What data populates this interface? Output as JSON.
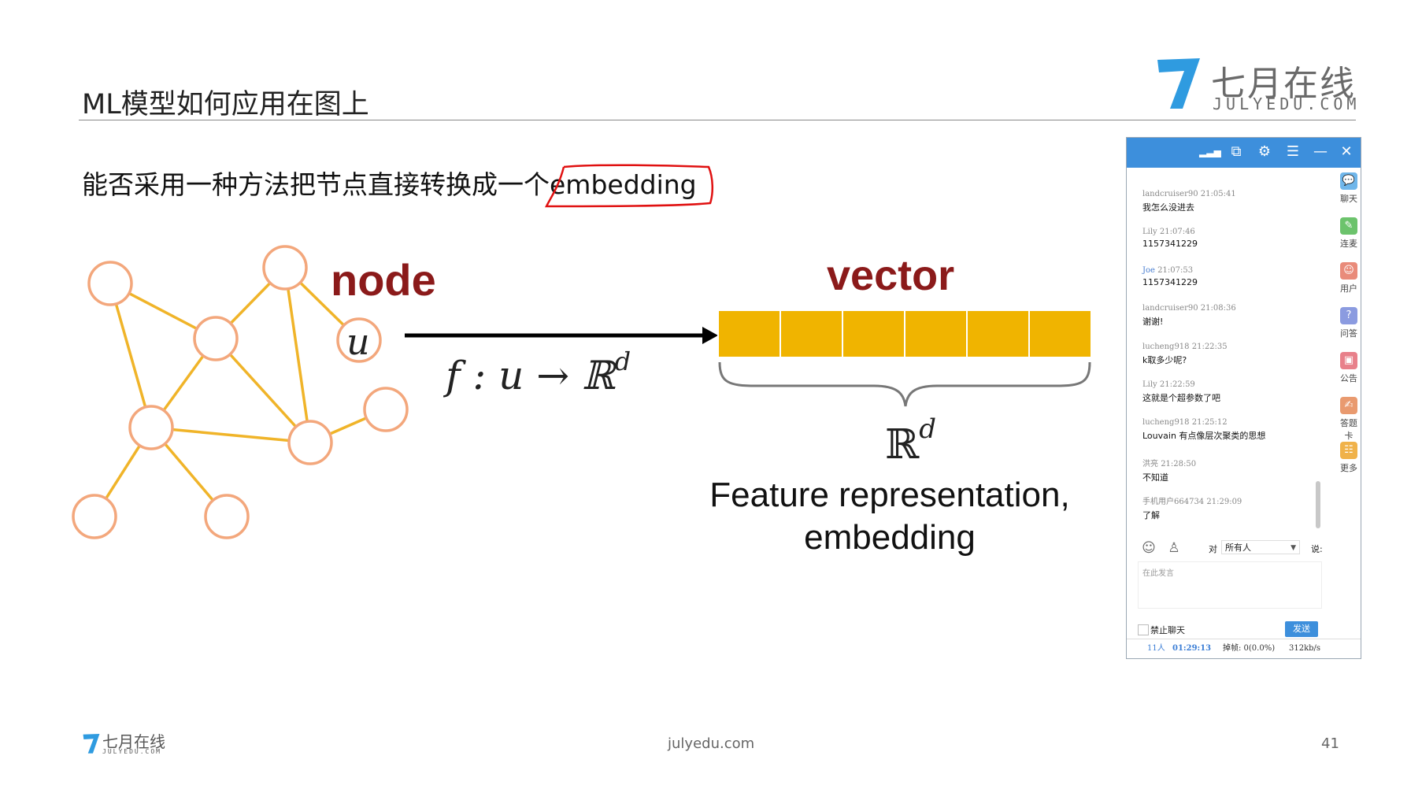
{
  "slide": {
    "title": "ML模型如何应用在图上",
    "question": "能否采用一种方法把节点直接转换成一个",
    "question_highlight": "embedding",
    "footer_url": "julyedu.com",
    "page_number": "41"
  },
  "brand": {
    "zh": "七月在线",
    "en": "JULYEDU.COM",
    "color": "#2f9be0"
  },
  "diagram": {
    "node_label": "node",
    "node_var": "u",
    "function": "f : u → ℝ",
    "function_sup": "d",
    "vector_label": "vector",
    "space": "ℝ",
    "space_sup": "d",
    "caption_line1": "Feature representation,",
    "caption_line2": "embedding",
    "vector_cells": 6,
    "colors": {
      "node_stroke": "#f3a77c",
      "edge": "#f0b429",
      "vector_fill": "#f0b400",
      "label": "#8b1a1a",
      "annotation": "#e01010"
    }
  },
  "chat": {
    "messages": [
      {
        "user": "landcruiser90",
        "time": "21:05:41",
        "text": "我怎么没进去"
      },
      {
        "user": "Lily",
        "time": "21:07:46",
        "text": "1157341229"
      },
      {
        "user": "Joe",
        "time": "21:07:53",
        "text": "1157341229",
        "highlight": true
      },
      {
        "user": "landcruiser90",
        "time": "21:08:36",
        "text": "谢谢!"
      },
      {
        "user": "lucheng918",
        "time": "21:22:35",
        "text": "k取多少呢?"
      },
      {
        "user": "Lily",
        "time": "21:22:59",
        "text": "这就是个超参数了吧"
      },
      {
        "user": "lucheng918",
        "time": "21:25:12",
        "text": "Louvain  有点像层次聚类的思想"
      },
      {
        "user": "洪亮",
        "time": "21:28:50",
        "text": "不知道"
      },
      {
        "user": "手机用户664734",
        "time": "21:29:09",
        "text": "了解"
      }
    ],
    "sidebar": [
      {
        "label": "聊天",
        "icon": "chat-bubble-icon",
        "color": "#6fb6ea"
      },
      {
        "label": "连麦",
        "icon": "pencil-icon",
        "color": "#6cc36c"
      },
      {
        "label": "用户",
        "icon": "user-icon",
        "color": "#e98b7a"
      },
      {
        "label": "问答",
        "icon": "question-icon",
        "color": "#8b9be0"
      },
      {
        "label": "公告",
        "icon": "announcement-icon",
        "color": "#e8808a"
      },
      {
        "label": "答题卡",
        "icon": "answer-card-icon",
        "color": "#e99a6f"
      },
      {
        "label": "更多",
        "icon": "more-grid-icon",
        "color": "#f0b24a"
      }
    ],
    "to_label": "对",
    "recipient": "所有人",
    "say_label": "说:",
    "input_placeholder": "在此发言",
    "ban_label": "禁止聊天",
    "send_label": "发送",
    "status": {
      "people": "11人",
      "time": "01:29:13",
      "drop": "掉帧: 0(0.0%)",
      "rate": "312kb/s"
    },
    "header_color": "#3d8fdc"
  }
}
